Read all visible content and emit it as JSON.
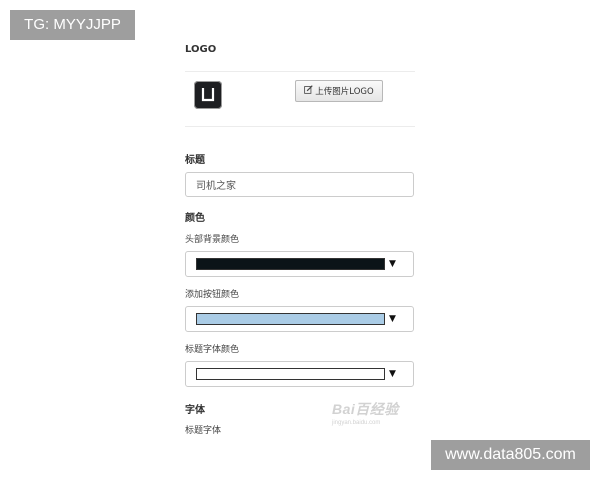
{
  "overlays": {
    "top_left_tag": "TG: MYYJJPP",
    "bottom_right_site": "www.data805.com"
  },
  "logo_section": {
    "title": "LOGO",
    "logo_icon": "u-logo-icon",
    "upload_button_icon": "edit-icon",
    "upload_button_label": "上传图片LOGO"
  },
  "title_section": {
    "title": "标题",
    "input_value": "司机之家"
  },
  "color_section": {
    "title": "颜色",
    "fields": [
      {
        "label": "头部背景颜色",
        "color": "#0b1418"
      },
      {
        "label": "添加按钮颜色",
        "color": "#aacce6"
      },
      {
        "label": "标题字体颜色",
        "color": "#ffffff"
      }
    ],
    "dropdown_arrow": "▼"
  },
  "font_section": {
    "title": "字体",
    "field_label": "标题字体"
  },
  "watermark": {
    "main": "Bai百经验",
    "sub": "jingyan.baidu.com"
  }
}
